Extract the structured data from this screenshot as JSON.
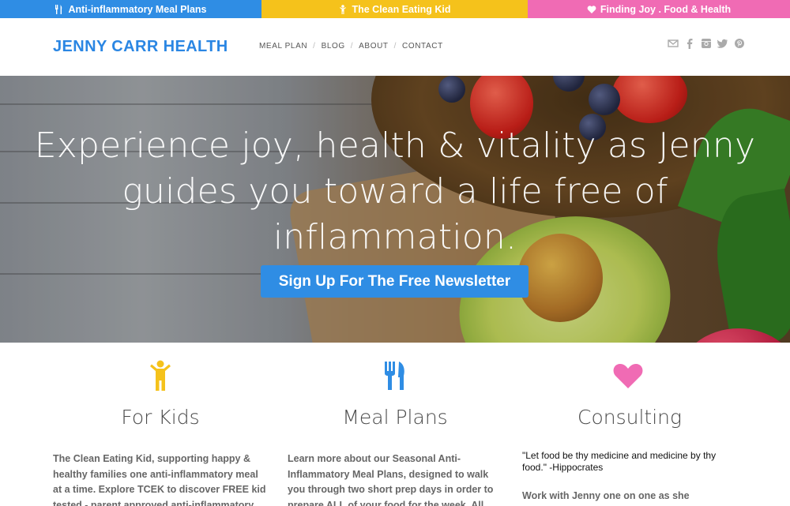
{
  "topbar": {
    "items": [
      {
        "label": "Anti-inflammatory Meal Plans",
        "icon": "fork-knife-icon",
        "color": "#2f8de4"
      },
      {
        "label": "The Clean Eating Kid",
        "icon": "kid-icon",
        "color": "#f5c21b"
      },
      {
        "label": "Finding Joy . Food & Health",
        "icon": "heart-icon",
        "color": "#f06bb4"
      }
    ]
  },
  "header": {
    "logo": "JENNY CARR HEALTH",
    "nav": [
      "MEAL PLAN",
      "BLOG",
      "ABOUT",
      "CONTACT"
    ],
    "social_icons": [
      "mail-icon",
      "facebook-icon",
      "instagram-icon",
      "twitter-icon",
      "pinterest-icon"
    ]
  },
  "hero": {
    "headline": "Experience joy, health & vitality as Jenny guides you toward a life free of inflammation.",
    "cta": "Sign Up For The Free Newsletter"
  },
  "columns": [
    {
      "title": "For Kids",
      "icon": "kid-icon",
      "color": "#f5c21b",
      "text": "The Clean Eating Kid, supporting happy & healthy families one anti-inflammatory meal at a time. Explore TCEK to discover FREE kid tested - parent approved anti-inflammatory recipes in"
    },
    {
      "title": "Meal Plans",
      "icon": "fork-knife-icon",
      "color": "#2f8de4",
      "text": "Learn more about our Seasonal Anti-Inflammatory Meal Plans, designed to walk you through two short prep days in order to prepare ALL of your food for the week. All recipes are"
    },
    {
      "title": "Consulting",
      "icon": "heart-icon",
      "color": "#f06bb4",
      "quote": "\"Let food be thy medicine and medicine by thy food.\"  -Hippocrates",
      "text": "Work with Jenny one on one as she formulates"
    }
  ]
}
